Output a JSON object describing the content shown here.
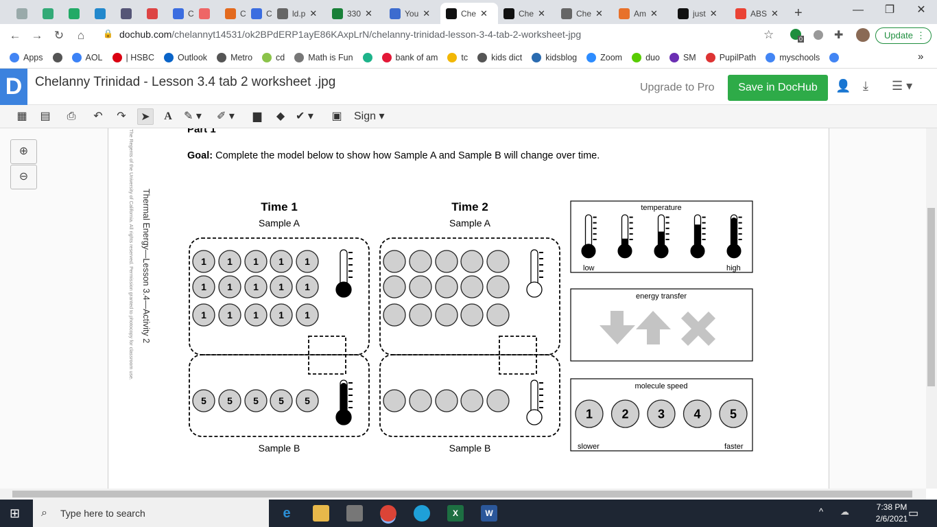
{
  "browser": {
    "tabs": [
      {
        "label": "",
        "color": "#9aa"
      },
      {
        "label": "",
        "color": "#3a7"
      },
      {
        "label": "",
        "color": "#2a6"
      },
      {
        "label": "",
        "color": "#28c"
      },
      {
        "label": "",
        "color": "#557"
      },
      {
        "label": "",
        "color": "#d44"
      },
      {
        "label": "C",
        "color": "#3b6de0"
      },
      {
        "label": "",
        "color": "#e66"
      },
      {
        "label": "C",
        "color": "#e36a1e"
      },
      {
        "label": "C",
        "color": "#3b6de0"
      },
      {
        "label": "ld.p",
        "color": "#666"
      },
      {
        "label": "330",
        "color": "#188038"
      },
      {
        "label": "You",
        "color": "#3d6ccf"
      },
      {
        "label": "Che",
        "color": "#111",
        "active": true
      },
      {
        "label": "Che",
        "color": "#111"
      },
      {
        "label": "Che",
        "color": "#666"
      },
      {
        "label": "Am",
        "color": "#e8712a"
      },
      {
        "label": "just",
        "color": "#111"
      },
      {
        "label": "ABS",
        "color": "#ea4335"
      }
    ],
    "new_tab": "+",
    "url_host": "dochub.com",
    "url_path": "/chelannyt14531/ok2BPdERP1ayE86KAxpLrN/chelanny-trinidad-lesson-3-4-tab-2-worksheet-jpg",
    "update_label": "Update",
    "extension_badge": "0",
    "bookmarks": [
      {
        "label": "Apps",
        "color": "#4285f4"
      },
      {
        "label": "",
        "color": "#555"
      },
      {
        "label": "AOL",
        "color": "#3b82f6"
      },
      {
        "label": "| HSBC",
        "color": "#db0011"
      },
      {
        "label": "Outlook",
        "color": "#0a64c8"
      },
      {
        "label": "Metro",
        "color": "#555"
      },
      {
        "label": "cd",
        "color": "#8bc34a"
      },
      {
        "label": "Math is Fun",
        "color": "#777"
      },
      {
        "label": "",
        "color": "#1db38a"
      },
      {
        "label": "bank of am",
        "color": "#e31837"
      },
      {
        "label": "tc",
        "color": "#f2b705"
      },
      {
        "label": "kids dict",
        "color": "#555"
      },
      {
        "label": "kidsblog",
        "color": "#2a6bb0"
      },
      {
        "label": "Zoom",
        "color": "#2d8cff"
      },
      {
        "label": "duo",
        "color": "#58cc02"
      },
      {
        "label": "SM",
        "color": "#6b2fb3"
      },
      {
        "label": "PupilPath",
        "color": "#d33"
      },
      {
        "label": "myschools",
        "color": "#4285f4"
      },
      {
        "label": "",
        "color": "#4285f4"
      }
    ],
    "more": "»"
  },
  "dochub": {
    "logo": "D",
    "title": "Chelanny Trinidad - Lesson 3.4 tab 2 worksheet .jpg",
    "upgrade": "Upgrade to Pro",
    "save": "Save in DocHub",
    "sign": "Sign ▾"
  },
  "worksheet": {
    "part": "Part 1",
    "goal_label": "Goal:",
    "goal_text": " Complete the model below to show how Sample A and Sample B will change over time.",
    "side_title": "Thermal Energy—Lesson 3.4—Activity 2",
    "copyright": "The Regents of the University of California. All rights reserved. Permission granted to photocopy for classroom use.",
    "times": [
      {
        "title": "Time 1",
        "sample_a_label": "Sample A",
        "sample_b_label": "Sample B",
        "sample_a": {
          "molecules": [
            "1",
            "1",
            "1",
            "1",
            "1",
            "1",
            "1",
            "1",
            "1",
            "1",
            "1",
            "1",
            "1",
            "1",
            "1"
          ],
          "temperature_level": 0.0
        },
        "sample_b": {
          "molecules": [
            "5",
            "5",
            "5",
            "5",
            "5"
          ],
          "temperature_level": 1.0
        }
      },
      {
        "title": "Time 2",
        "sample_a_label": "Sample A",
        "sample_b_label": "Sample B",
        "sample_a": {
          "molecules": [
            "",
            "",
            "",
            "",
            "",
            "",
            "",
            "",
            "",
            "",
            "",
            "",
            "",
            "",
            ""
          ],
          "temperature_level": null
        },
        "sample_b": {
          "molecules": [
            "",
            "",
            "",
            "",
            ""
          ],
          "temperature_level": null
        }
      }
    ],
    "legend": {
      "temperature": {
        "title": "temperature",
        "low": "low",
        "high": "high",
        "levels": [
          0,
          0.25,
          0.5,
          0.75,
          1
        ]
      },
      "energy_transfer": {
        "title": "energy transfer",
        "symbols": [
          "arrow-down",
          "arrow-up",
          "x-mark"
        ],
        "color": "#c4c4c4"
      },
      "molecule_speed": {
        "title": "molecule speed",
        "values": [
          "1",
          "2",
          "3",
          "4",
          "5"
        ],
        "slower": "slower",
        "faster": "faster"
      }
    },
    "molecule_color": "#d0d0d0"
  },
  "taskbar": {
    "search_placeholder": "Type here to search",
    "time": "7:38 PM",
    "date": "2/6/2021"
  }
}
